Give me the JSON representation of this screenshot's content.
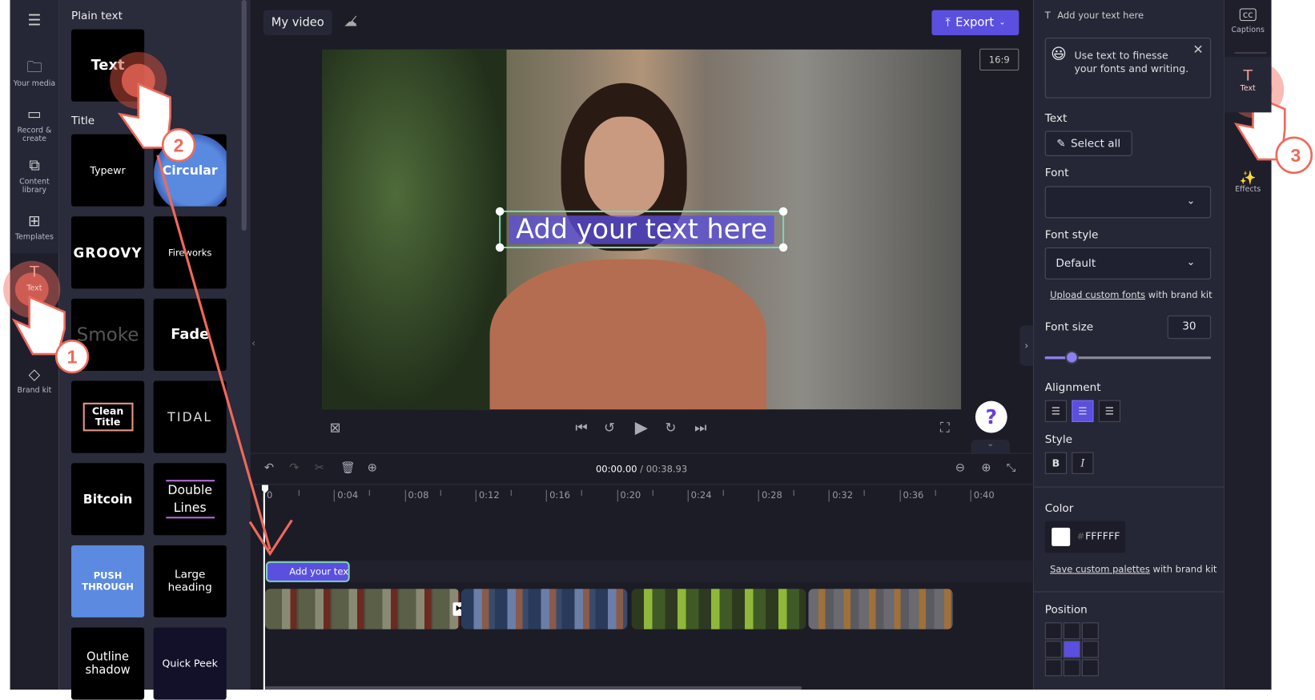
{
  "left_nav": {
    "menu_icon": "hamburger-icon",
    "items": [
      {
        "label": "Your media",
        "icon": "folder-icon"
      },
      {
        "label": "Record & create",
        "icon": "camera-icon"
      },
      {
        "label": "Content library",
        "icon": "library-icon"
      },
      {
        "label": "Templates",
        "icon": "templates-icon"
      },
      {
        "label": "Text",
        "icon": "text-icon",
        "active": true
      },
      {
        "label": "Brand kit",
        "icon": "brand-kit-icon"
      }
    ]
  },
  "text_panel": {
    "plain_heading": "Plain text",
    "plain_tile": "Text",
    "title_heading": "Title",
    "tiles": [
      "Typewr",
      "Circular",
      "GROOVY",
      "Fireworks",
      "Smoke",
      "Fade",
      "Clean Title",
      "TIDAL",
      "Bitcoin",
      "Double Lines",
      "PUSH THROUGH",
      "Large heading",
      "Outline shadow",
      "Quick Peek"
    ]
  },
  "header": {
    "project_name": "My video",
    "cloud_icon": "cloud-off-icon",
    "export_label": "Export",
    "aspect_ratio": "16:9"
  },
  "preview": {
    "overlay_text": "Add your text here"
  },
  "playback": {
    "current_time": "00:00.00",
    "separator": " / ",
    "total_time": "00:38.93"
  },
  "timeline": {
    "ticks": [
      "0",
      "0:04",
      "0:08",
      "0:12",
      "0:16",
      "0:20",
      "0:24",
      "0:28",
      "0:32",
      "0:36",
      "0:40"
    ],
    "text_clip": "Add your text"
  },
  "properties": {
    "header": "Add your text here",
    "tip": "Use text to finesse your fonts and writing.",
    "text_label": "Text",
    "select_all": "Select all",
    "font_label": "Font",
    "font_value": "",
    "font_style_label": "Font style",
    "font_style_value": "Default",
    "upload_link": "Upload custom fonts",
    "upload_suffix": " with brand kit",
    "font_size_label": "Font size",
    "font_size_value": "30",
    "font_size_slider_percent": 16,
    "alignment_label": "Alignment",
    "alignment_selected": "center",
    "style_label": "Style",
    "bold": "B",
    "italic": "I",
    "color_label": "Color",
    "color_hash": "#",
    "color_value": "FFFFFF",
    "palette_link": "Save custom palettes",
    "palette_suffix": " with brand kit",
    "position_label": "Position",
    "position_selected": "middle-center"
  },
  "right_rail": {
    "items": [
      {
        "label": "Captions",
        "icon": "captions-icon"
      },
      {
        "label": "Text",
        "icon": "text-icon",
        "active": true
      },
      {
        "label": "Effects",
        "icon": "effects-icon"
      }
    ]
  },
  "annotations": {
    "steps": [
      "1",
      "2",
      "3"
    ]
  },
  "colors": {
    "accent": "#5b4fe0",
    "pointer": "#f0695a",
    "text_clip_border": "#7fd1b9"
  }
}
